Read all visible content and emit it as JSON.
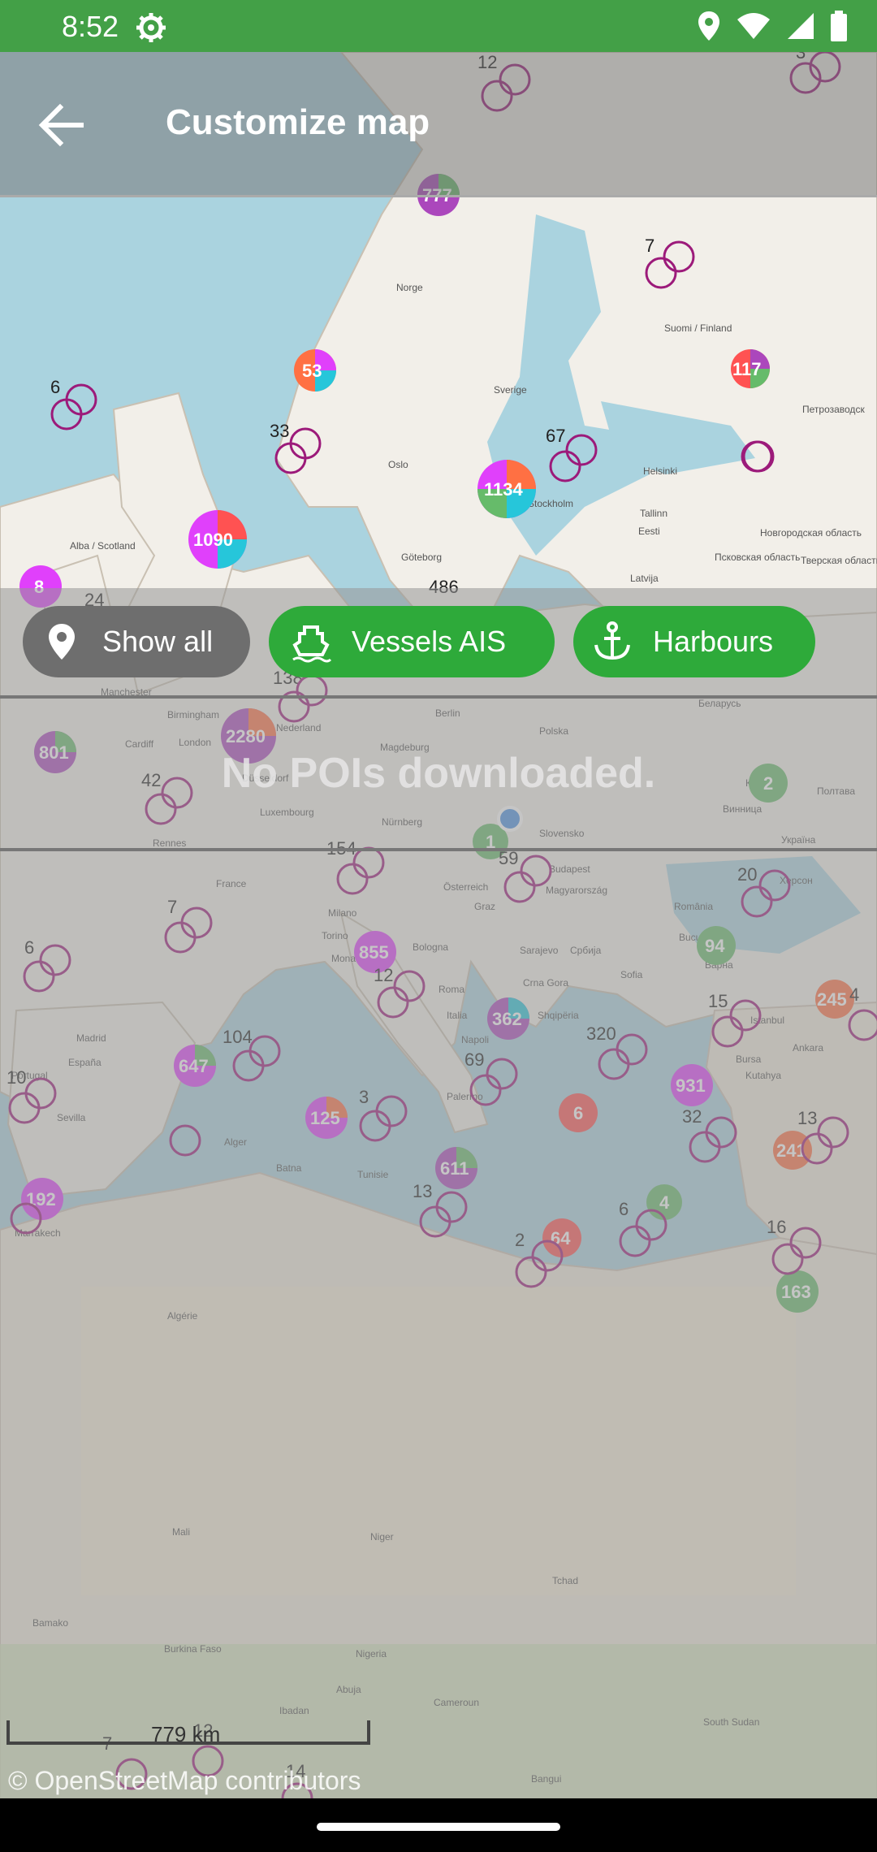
{
  "status": {
    "time": "8:52"
  },
  "header": {
    "title": "Customize map",
    "back_icon": "arrow-back-icon"
  },
  "filters": [
    {
      "label": "Show all",
      "icon": "location-pin-icon",
      "active": false
    },
    {
      "label": "Vessels AIS",
      "icon": "ship-icon",
      "active": true
    },
    {
      "label": "Harbours",
      "icon": "anchor-icon",
      "active": true
    }
  ],
  "message": "No POIs downloaded.",
  "map": {
    "scale_label": "779 km",
    "attribution": "© OpenStreetMap contributors",
    "cluster_counts": [
      "53",
      "117",
      "1134",
      "1090",
      "8",
      "2280",
      "801",
      "855",
      "362",
      "647",
      "125",
      "611",
      "192",
      "64",
      "163",
      "931",
      "245",
      "241",
      "94",
      "6",
      "4",
      "2",
      "1",
      "777"
    ],
    "marker_counts": [
      "12",
      "3",
      "7",
      "6",
      "33",
      "67",
      "486",
      "24",
      "138",
      "42",
      "154",
      "59",
      "20",
      "7",
      "6",
      "12",
      "104",
      "10",
      "3",
      "69",
      "320",
      "15",
      "4",
      "13",
      "32",
      "6",
      "16",
      "2",
      "13",
      "12",
      "7",
      "14"
    ],
    "place_names": [
      "Norge",
      "Sverige",
      "Suomi / Finland",
      "Oslo",
      "Stockholm",
      "Helsinki",
      "Tallinn",
      "Eesti",
      "Göteborg",
      "Latvija",
      "Alba / Scotland",
      "Birmingham",
      "London",
      "Cardiff",
      "Manchester",
      "Nederland",
      "Berlin",
      "Polska",
      "Magdeburg",
      "Düsseldorf",
      "Luxembourg",
      "France",
      "Rennes",
      "Nürnberg",
      "Slovensko",
      "Österreich",
      "Graz",
      "Budapest",
      "Magyarország",
      "Milano",
      "Torino",
      "Monaco",
      "Bologna",
      "Italia",
      "Roma",
      "Napoli",
      "Palermo",
      "Sarajevo",
      "Србија",
      "Crna Gora",
      "Shqipëria",
      "București",
      "Sofia",
      "România",
      "Варна",
      "Istanbul",
      "Bursa",
      "Ankara",
      "Kutahya",
      "Madrid",
      "España",
      "Sevilla",
      "Portugal",
      "Alger",
      "Batna",
      "Tunisie",
      "Marrakech",
      "Algérie",
      "Mali",
      "Niger",
      "Bamako",
      "Burkina Faso",
      "Nigeria",
      "Abuja",
      "Ibadan",
      "Tchad",
      "Cameroun",
      "Bangui",
      "South Sudan",
      "Київ",
      "Україна",
      "Херсон",
      "Полтава",
      "Винница",
      "Беларусь",
      "Тверская область",
      "Петрозаводск",
      "Новгородская область",
      "Псковская область"
    ]
  }
}
